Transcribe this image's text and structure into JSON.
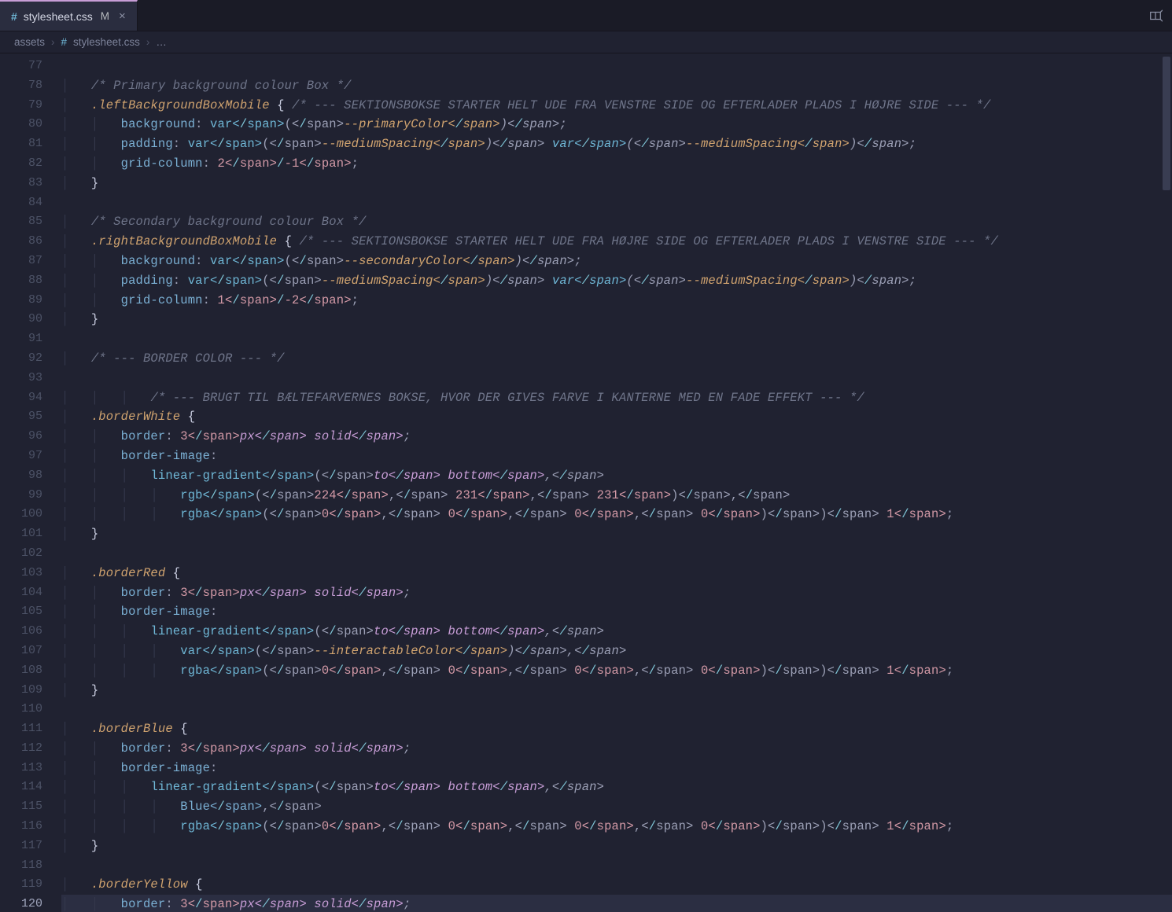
{
  "tab": {
    "icon": "#",
    "filename": "stylesheet.css",
    "modified_indicator": "M",
    "close_glyph": "×"
  },
  "breadcrumb": {
    "segments": [
      "assets",
      "stylesheet.css"
    ],
    "trailing_ellipsis": "…",
    "separator": "›"
  },
  "editor": {
    "first_line_number": 77,
    "last_line_number": 120,
    "active_line_number": 120,
    "lines": [
      {
        "n": 77,
        "raw": ""
      },
      {
        "n": 78,
        "raw": "    /* Primary background colour Box */"
      },
      {
        "n": 79,
        "raw": "    .leftBackgroundBoxMobile { /* --- SEKTIONSBOKSE STARTER HELT UDE FRA VENSTRE SIDE OG EFTERLADER PLADS I HØJRE SIDE --- */"
      },
      {
        "n": 80,
        "raw": "        background: var(--primaryColor);"
      },
      {
        "n": 81,
        "raw": "        padding: var(--mediumSpacing) var(--mediumSpacing);"
      },
      {
        "n": 82,
        "raw": "        grid-column: 2/-1;"
      },
      {
        "n": 83,
        "raw": "    }"
      },
      {
        "n": 84,
        "raw": ""
      },
      {
        "n": 85,
        "raw": "    /* Secondary background colour Box */"
      },
      {
        "n": 86,
        "raw": "    .rightBackgroundBoxMobile { /* --- SEKTIONSBOKSE STARTER HELT UDE FRA HØJRE SIDE OG EFTERLADER PLADS I VENSTRE SIDE --- */"
      },
      {
        "n": 87,
        "raw": "        background: var(--secondaryColor);"
      },
      {
        "n": 88,
        "raw": "        padding: var(--mediumSpacing) var(--mediumSpacing);"
      },
      {
        "n": 89,
        "raw": "        grid-column: 1/-2;"
      },
      {
        "n": 90,
        "raw": "    }"
      },
      {
        "n": 91,
        "raw": ""
      },
      {
        "n": 92,
        "raw": "    /* --- BORDER COLOR --- */"
      },
      {
        "n": 93,
        "raw": ""
      },
      {
        "n": 94,
        "raw": "            /* --- BRUGT TIL BÆLTEFARVERNES BOKSE, HVOR DER GIVES FARVE I KANTERNE MED EN FADE EFFEKT --- */"
      },
      {
        "n": 95,
        "raw": "    .borderWhite {"
      },
      {
        "n": 96,
        "raw": "        border: 3px solid;"
      },
      {
        "n": 97,
        "raw": "        border-image:"
      },
      {
        "n": 98,
        "raw": "            linear-gradient(to bottom,"
      },
      {
        "n": 99,
        "raw": "                rgb(224, 231, 231),",
        "swatch": "#e0e7e7"
      },
      {
        "n": 100,
        "raw": "                rgba(0, 0, 0, 0)) 1;",
        "swatch": "transparent"
      },
      {
        "n": 101,
        "raw": "    }"
      },
      {
        "n": 102,
        "raw": ""
      },
      {
        "n": 103,
        "raw": "    .borderRed {"
      },
      {
        "n": 104,
        "raw": "        border: 3px solid;"
      },
      {
        "n": 105,
        "raw": "        border-image:"
      },
      {
        "n": 106,
        "raw": "            linear-gradient(to bottom,"
      },
      {
        "n": 107,
        "raw": "                var(--interactableColor),"
      },
      {
        "n": 108,
        "raw": "                rgba(0, 0, 0, 0)) 1;",
        "swatch": "transparent"
      },
      {
        "n": 109,
        "raw": "    }"
      },
      {
        "n": 110,
        "raw": ""
      },
      {
        "n": 111,
        "raw": "    .borderBlue {"
      },
      {
        "n": 112,
        "raw": "        border: 3px solid;"
      },
      {
        "n": 113,
        "raw": "        border-image:"
      },
      {
        "n": 114,
        "raw": "            linear-gradient(to bottom,"
      },
      {
        "n": 115,
        "raw": "                Blue,",
        "swatch": "#0000ff"
      },
      {
        "n": 116,
        "raw": "                rgba(0, 0, 0, 0)) 1;",
        "swatch": "transparent"
      },
      {
        "n": 117,
        "raw": "    }"
      },
      {
        "n": 118,
        "raw": ""
      },
      {
        "n": 119,
        "raw": "    .borderYellow {"
      },
      {
        "n": 120,
        "raw": "        border: 3px solid;"
      }
    ]
  }
}
